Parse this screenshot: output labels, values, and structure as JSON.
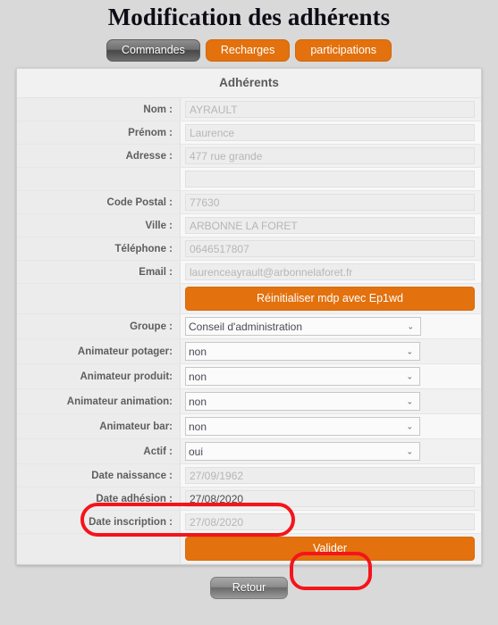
{
  "page": {
    "title": "Modification des adhérents",
    "background_color": "#d9d9d9"
  },
  "tabs": [
    {
      "label": "Commandes",
      "style": "gray",
      "color": "#6f6f6f"
    },
    {
      "label": "Recharges",
      "style": "orange",
      "color": "#e2710e"
    },
    {
      "label": "participations",
      "style": "orange",
      "color": "#e2710e"
    }
  ],
  "panel": {
    "header": "Adhérents",
    "rows": [
      {
        "label": "Nom :",
        "value": "AYRAULT",
        "type": "text",
        "state": "disabled"
      },
      {
        "label": "Prénom :",
        "value": "Laurence",
        "type": "text",
        "state": "disabled"
      },
      {
        "label": "Adresse :",
        "value": "477 rue grande",
        "type": "text",
        "state": "disabled"
      },
      {
        "label": "",
        "value": "",
        "type": "text",
        "state": "disabled"
      },
      {
        "label": "Code Postal :",
        "value": "77630",
        "type": "text",
        "state": "disabled"
      },
      {
        "label": "Ville :",
        "value": "ARBONNE LA FORET",
        "type": "text",
        "state": "disabled"
      },
      {
        "label": "Téléphone :",
        "value": "0646517807",
        "type": "text",
        "state": "disabled"
      },
      {
        "label": "Email :",
        "value": "laurenceayrault@arbonnelaforet.fr",
        "type": "text",
        "state": "disabled"
      },
      {
        "label": "",
        "value": "Réinitialiser mdp avec Ep1wd",
        "type": "button",
        "state": "enabled"
      },
      {
        "label": "Groupe :",
        "value": "Conseil d'administration",
        "type": "select",
        "state": "enabled"
      },
      {
        "label": "Animateur potager:",
        "value": "non",
        "type": "select",
        "state": "enabled"
      },
      {
        "label": "Animateur produit:",
        "value": "non",
        "type": "select",
        "state": "enabled"
      },
      {
        "label": "Animateur animation:",
        "value": "non",
        "type": "select",
        "state": "enabled"
      },
      {
        "label": "Animateur bar:",
        "value": "non",
        "type": "select",
        "state": "enabled"
      },
      {
        "label": "Actif :",
        "value": "oui",
        "type": "select",
        "state": "enabled"
      },
      {
        "label": "Date naissance :",
        "value": "27/09/1962",
        "type": "text",
        "state": "disabled"
      },
      {
        "label": "Date adhésion :",
        "value": "27/08/2020",
        "type": "text",
        "state": "filled"
      },
      {
        "label": "Date inscription :",
        "value": "27/08/2020",
        "type": "text",
        "state": "disabled"
      },
      {
        "label": "",
        "value": "Valider",
        "type": "button",
        "state": "enabled"
      }
    ]
  },
  "footer": {
    "back_label": "Retour"
  },
  "annotations": {
    "color": "#f5141b",
    "items": [
      {
        "name": "date-adhesion-highlight",
        "target": "Date adhésion :"
      },
      {
        "name": "valider-highlight",
        "target": "Valider"
      }
    ]
  },
  "icons": {
    "chevron_down": "⌄"
  }
}
